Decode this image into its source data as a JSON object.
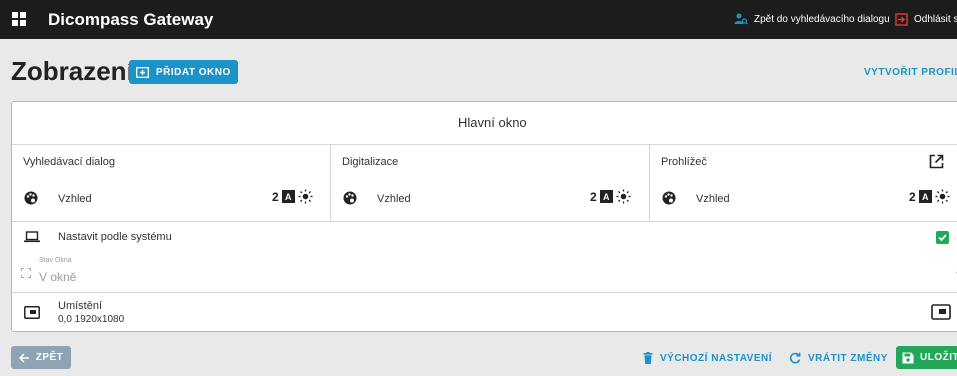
{
  "app": {
    "title": "Dicompass Gateway"
  },
  "topbar": {
    "back_to_search": "Zpět do vyhledávacího dialogu",
    "logout": "Odhlásit se"
  },
  "page": {
    "title": "Zobrazení",
    "add_window": "PŘIDAT OKNO",
    "create_profile": "VYTVOŘIT PROFIL"
  },
  "card": {
    "header": "Hlavní okno",
    "columns": [
      {
        "title": "Vyhledávací dialog",
        "vzhled": "Vzhled",
        "theme_num": "2",
        "theme_badge": "A"
      },
      {
        "title": "Digitalizace",
        "vzhled": "Vzhled",
        "theme_num": "2",
        "theme_badge": "A"
      },
      {
        "title": "Prohlížeč",
        "vzhled": "Vzhled",
        "theme_num": "2",
        "theme_badge": "A"
      }
    ],
    "system_setting": {
      "label": "Nastavit podle systému",
      "checked": true
    },
    "window_state": {
      "label": "Stav Okna",
      "value": "V okně"
    },
    "placement": {
      "label": "Umístění",
      "value": "0,0 1920x1080"
    }
  },
  "footer": {
    "back": "ZPĚT",
    "defaults": "VÝCHOZÍ NASTAVENÍ",
    "revert": "VRÁTIT ZMĚNY",
    "save": "ULOŽIT"
  },
  "colors": {
    "topbar_bg": "#1c1c1c",
    "accent_blue": "#1a93c9",
    "success_green": "#23a85a",
    "back_button": "#8ea4b5",
    "page_bg": "#e9e9e9"
  }
}
